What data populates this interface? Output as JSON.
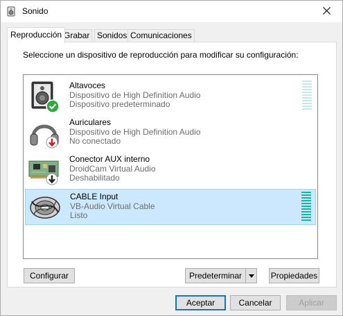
{
  "window": {
    "title": "Sonido"
  },
  "tabs": [
    {
      "label": "Reproducción",
      "active": true
    },
    {
      "label": "Grabar",
      "active": false
    },
    {
      "label": "Sonidos",
      "active": false
    },
    {
      "label": "Comunicaciones",
      "active": false
    }
  ],
  "panel": {
    "instruction": "Seleccione un dispositivo de reproducción para modificar su configuración:"
  },
  "devices": [
    {
      "name": "Altavoces",
      "driver": "Dispositivo de High Definition Audio",
      "status": "Dispositivo predeterminado",
      "icon": "speaker-icon",
      "badge": "default-check-icon",
      "selected": false,
      "level": 0,
      "meter_shown": true
    },
    {
      "name": "Auriculares",
      "driver": "Dispositivo de High Definition Audio",
      "status": "No conectado",
      "icon": "headphones-icon",
      "badge": "not-connected-arrow-icon",
      "selected": false,
      "level": 0,
      "meter_shown": false
    },
    {
      "name": "Conector AUX interno",
      "driver": "DroidCam Virtual Audio",
      "status": "Deshabilitado",
      "icon": "circuit-board-icon",
      "badge": "disabled-arrow-icon",
      "selected": false,
      "level": 0,
      "meter_shown": false
    },
    {
      "name": "CABLE Input",
      "driver": "VB-Audio Virtual Cable",
      "status": "Listo",
      "icon": "cable-reel-icon",
      "badge": "",
      "selected": true,
      "level": 0,
      "meter_shown": true
    }
  ],
  "buttons": {
    "configure": "Configurar",
    "set_default": "Predeterminar",
    "properties": "Propiedades",
    "accept": "Aceptar",
    "cancel": "Cancelar",
    "apply": "Aplicar"
  },
  "colors": {
    "selection_bg": "#cce8ff",
    "selection_border": "#99d1ff",
    "meter_active": "#18b39b",
    "meter_idle": "#c9e6e6",
    "check_green": "#2eaa3c",
    "arrow_red": "#d21a1a",
    "primary_border": "#0078d7"
  }
}
